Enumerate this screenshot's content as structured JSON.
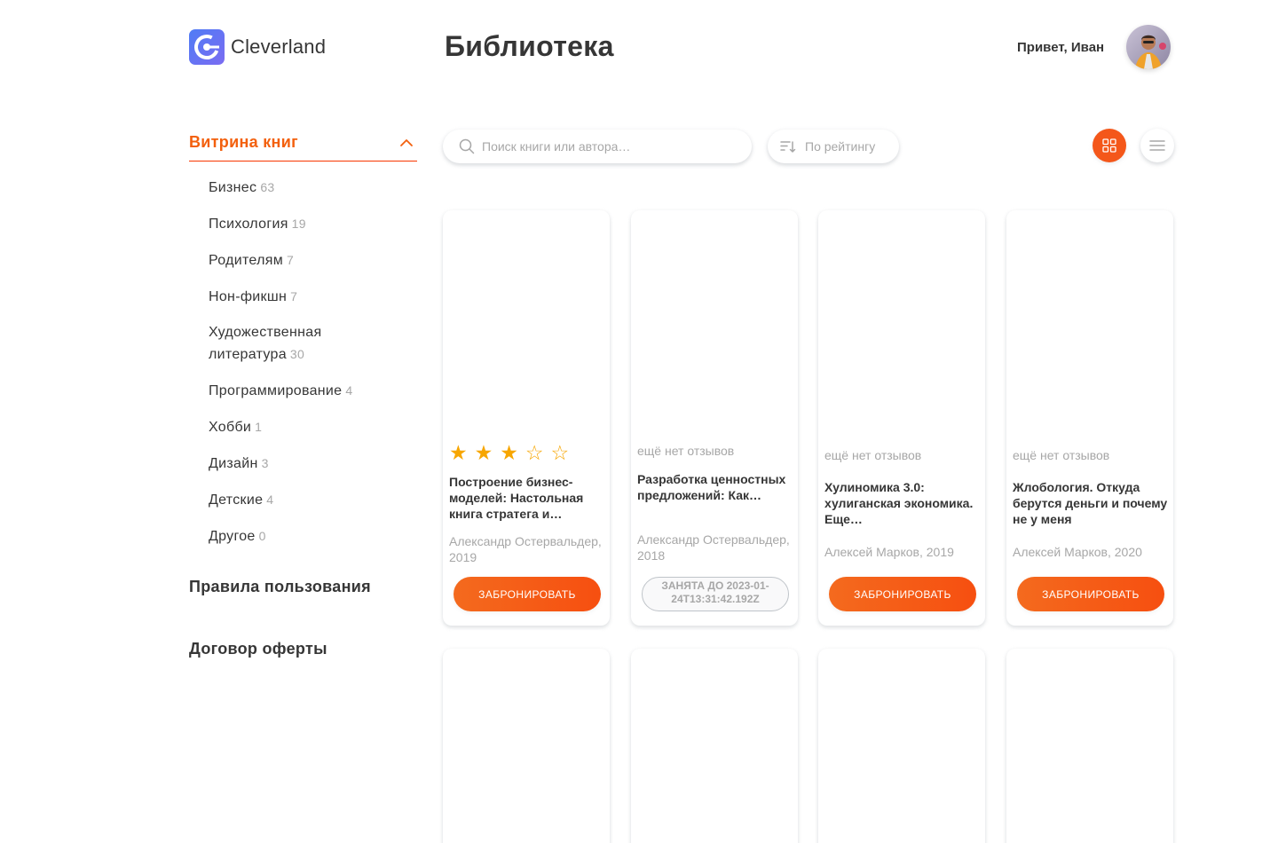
{
  "header": {
    "logo_text": "Cleverland",
    "page_title": "Библиотека",
    "greeting": "Привет, Иван"
  },
  "sidebar": {
    "showcase_label": "Витрина книг",
    "genres": [
      {
        "name": "Бизнес",
        "count": "63"
      },
      {
        "name": "Психология",
        "count": "19"
      },
      {
        "name": "Родителям",
        "count": "7"
      },
      {
        "name": "Нон-фикшн",
        "count": "7"
      },
      {
        "name": "Художественная литература",
        "count": "30"
      },
      {
        "name": "Программирование",
        "count": "4"
      },
      {
        "name": "Хобби",
        "count": "1"
      },
      {
        "name": "Дизайн",
        "count": "3"
      },
      {
        "name": "Детские",
        "count": "4"
      },
      {
        "name": "Другое",
        "count": "0"
      }
    ],
    "rules_label": "Правила пользования",
    "offer_label": "Договор оферты"
  },
  "toolbar": {
    "search_placeholder": "Поиск книги или автора…",
    "sort_label": "По рейтингу",
    "active_view": "grid"
  },
  "colors": {
    "accent": "#f3600d",
    "star": "#f7a600",
    "muted": "#a7a7a7",
    "text": "#363636"
  },
  "books": [
    {
      "rating": 3,
      "rating_max": 5,
      "reviews_text": "",
      "title": "Построение бизнес-моделей: Настольная книга стратега и…",
      "author": "Александр Остервальдер, 2019",
      "button": "Забронировать",
      "status": "available"
    },
    {
      "rating": null,
      "reviews_text": "ещё нет отзывов",
      "title": "Разработка ценностных предложений: Как…",
      "author": "Александр Остервальдер, 2018",
      "button": "Занята до 2023-01-24T13:31:42.192Z",
      "status": "busy"
    },
    {
      "rating": null,
      "reviews_text": "ещё нет отзывов",
      "title": "Хулиномика 3.0: хулиганская экономика. Еще…",
      "author": "Алексей Марков, 2019",
      "button": "Забронировать",
      "status": "available"
    },
    {
      "rating": null,
      "reviews_text": "ещё нет отзывов",
      "title": "Жлобология. Откуда берутся деньги и почему не у меня",
      "author": "Алексей Марков, 2020",
      "button": "Забронировать",
      "status": "available"
    }
  ]
}
